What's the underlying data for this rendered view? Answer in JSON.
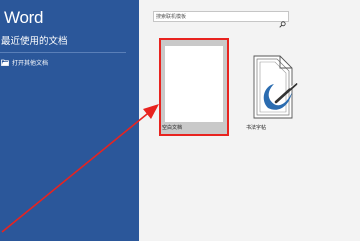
{
  "sidebar": {
    "app_title": "Word",
    "recent_label": "最近使用的文档",
    "open_other_label": "打开其他文档"
  },
  "search": {
    "placeholder": "搜索联机模板"
  },
  "templates": [
    {
      "label": "空白文档"
    },
    {
      "label": "书法字帖"
    }
  ],
  "colors": {
    "sidebar": "#2b579a",
    "highlight": "#e8231f",
    "background": "#f3f3f3"
  },
  "icons": [
    "folder-open-icon",
    "search-icon",
    "calligraphy-brush-icon",
    "annotation-arrow"
  ]
}
